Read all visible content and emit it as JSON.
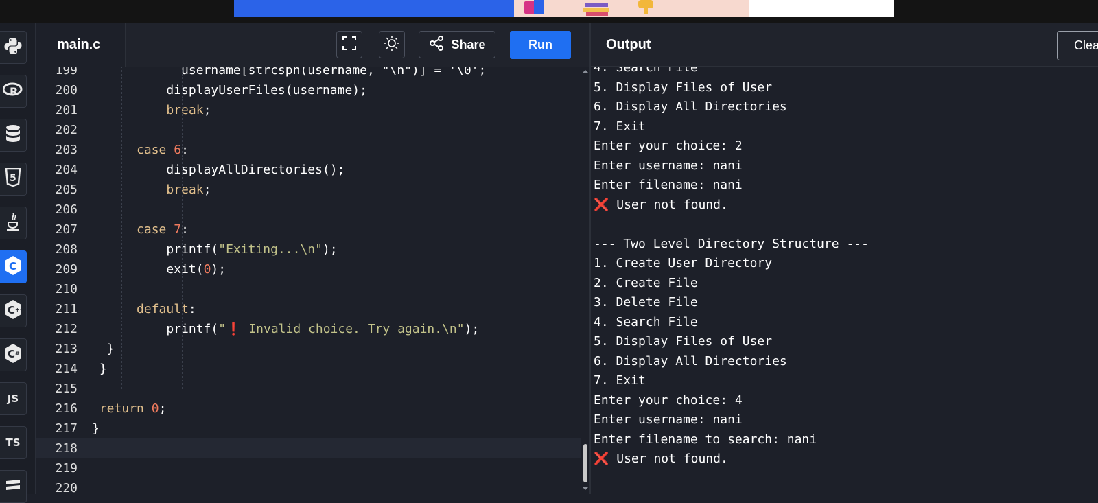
{
  "editor": {
    "tab_label": "main.c",
    "share_label": "Share",
    "run_label": "Run",
    "code_lines": [
      {
        "n": "199",
        "segs": [
          {
            "t": "            username[strcspn(username, \"\\n\")] = '\\0';",
            "c": "fn"
          }
        ]
      },
      {
        "n": "200",
        "segs": [
          {
            "t": "          displayUserFiles(username);",
            "c": "fn"
          }
        ]
      },
      {
        "n": "201",
        "segs": [
          {
            "t": "          ",
            "c": "fn"
          },
          {
            "t": "break",
            "c": "kw"
          },
          {
            "t": ";",
            "c": "fn"
          }
        ]
      },
      {
        "n": "202",
        "segs": []
      },
      {
        "n": "203",
        "segs": [
          {
            "t": "      ",
            "c": "fn"
          },
          {
            "t": "case",
            "c": "kw"
          },
          {
            "t": " ",
            "c": "fn"
          },
          {
            "t": "6",
            "c": "num"
          },
          {
            "t": ":",
            "c": "fn"
          }
        ]
      },
      {
        "n": "204",
        "segs": [
          {
            "t": "          displayAllDirectories();",
            "c": "fn"
          }
        ]
      },
      {
        "n": "205",
        "segs": [
          {
            "t": "          ",
            "c": "fn"
          },
          {
            "t": "break",
            "c": "kw"
          },
          {
            "t": ";",
            "c": "fn"
          }
        ]
      },
      {
        "n": "206",
        "segs": []
      },
      {
        "n": "207",
        "segs": [
          {
            "t": "      ",
            "c": "fn"
          },
          {
            "t": "case",
            "c": "kw"
          },
          {
            "t": " ",
            "c": "fn"
          },
          {
            "t": "7",
            "c": "num"
          },
          {
            "t": ":",
            "c": "fn"
          }
        ]
      },
      {
        "n": "208",
        "segs": [
          {
            "t": "          printf(",
            "c": "fn"
          },
          {
            "t": "\"Exiting...\\n\"",
            "c": "str"
          },
          {
            "t": ");",
            "c": "fn"
          }
        ]
      },
      {
        "n": "209",
        "segs": [
          {
            "t": "          exit(",
            "c": "fn"
          },
          {
            "t": "0",
            "c": "num"
          },
          {
            "t": ");",
            "c": "fn"
          }
        ]
      },
      {
        "n": "210",
        "segs": []
      },
      {
        "n": "211",
        "segs": [
          {
            "t": "      ",
            "c": "fn"
          },
          {
            "t": "default",
            "c": "kw"
          },
          {
            "t": ":",
            "c": "fn"
          }
        ]
      },
      {
        "n": "212",
        "segs": [
          {
            "t": "          printf(",
            "c": "fn"
          },
          {
            "t": "\"",
            "c": "str"
          },
          {
            "t": "❗",
            "c": "excl"
          },
          {
            "t": " Invalid choice. Try again.\\n\"",
            "c": "str"
          },
          {
            "t": ");",
            "c": "fn"
          }
        ]
      },
      {
        "n": "213",
        "segs": [
          {
            "t": "  }",
            "c": "fn"
          }
        ]
      },
      {
        "n": "214",
        "segs": [
          {
            "t": " }",
            "c": "fn"
          }
        ]
      },
      {
        "n": "215",
        "segs": []
      },
      {
        "n": "216",
        "segs": [
          {
            "t": " ",
            "c": "fn"
          },
          {
            "t": "return",
            "c": "kw"
          },
          {
            "t": " ",
            "c": "fn"
          },
          {
            "t": "0",
            "c": "num"
          },
          {
            "t": ";",
            "c": "fn"
          }
        ]
      },
      {
        "n": "217",
        "segs": [
          {
            "t": "}",
            "c": "fn"
          }
        ]
      },
      {
        "n": "218",
        "segs": []
      },
      {
        "n": "219",
        "segs": []
      },
      {
        "n": "220",
        "segs": []
      }
    ]
  },
  "output": {
    "title": "Output",
    "clear_label": "Clear",
    "lines": [
      {
        "text": "4. Search File"
      },
      {
        "text": "5. Display Files of User"
      },
      {
        "text": "6. Display All Directories"
      },
      {
        "text": "7. Exit"
      },
      {
        "text": "Enter your choice: 2"
      },
      {
        "text": "Enter username: nani"
      },
      {
        "text": "Enter filename: nani"
      },
      {
        "mark": "❌",
        "text": " User not found."
      },
      {
        "text": ""
      },
      {
        "text": "--- Two Level Directory Structure ---"
      },
      {
        "text": "1. Create User Directory"
      },
      {
        "text": "2. Create File"
      },
      {
        "text": "3. Delete File"
      },
      {
        "text": "4. Search File"
      },
      {
        "text": "5. Display Files of User"
      },
      {
        "text": "6. Display All Directories"
      },
      {
        "text": "7. Exit"
      },
      {
        "text": "Enter your choice: 4"
      },
      {
        "text": "Enter username: nani"
      },
      {
        "text": "Enter filename to search: nani"
      },
      {
        "mark": "❌",
        "text": " User not found."
      }
    ]
  },
  "sidebar": {
    "languages": [
      {
        "name": "python",
        "label": "",
        "icon": "python-icon"
      },
      {
        "name": "r",
        "label": "R",
        "icon": "r-icon"
      },
      {
        "name": "sql",
        "label": "",
        "icon": "database-icon"
      },
      {
        "name": "html",
        "label": "5",
        "icon": "html5-icon"
      },
      {
        "name": "java",
        "label": "",
        "icon": "java-icon"
      },
      {
        "name": "c",
        "label": "C",
        "icon": "c-icon",
        "active": true
      },
      {
        "name": "cpp",
        "label": "C",
        "icon": "cpp-icon"
      },
      {
        "name": "csharp",
        "label": "C",
        "icon": "csharp-icon"
      },
      {
        "name": "javascript",
        "label": "JS",
        "icon": "javascript-icon"
      },
      {
        "name": "typescript",
        "label": "TS",
        "icon": "typescript-icon"
      },
      {
        "name": "more",
        "label": "",
        "icon": "more-icon"
      }
    ]
  },
  "colors": {
    "accent": "#1f6ff2",
    "keyword": "#e2c08d",
    "number": "#f07b5e",
    "string": "#c3c38a",
    "error": "#e5484d"
  }
}
